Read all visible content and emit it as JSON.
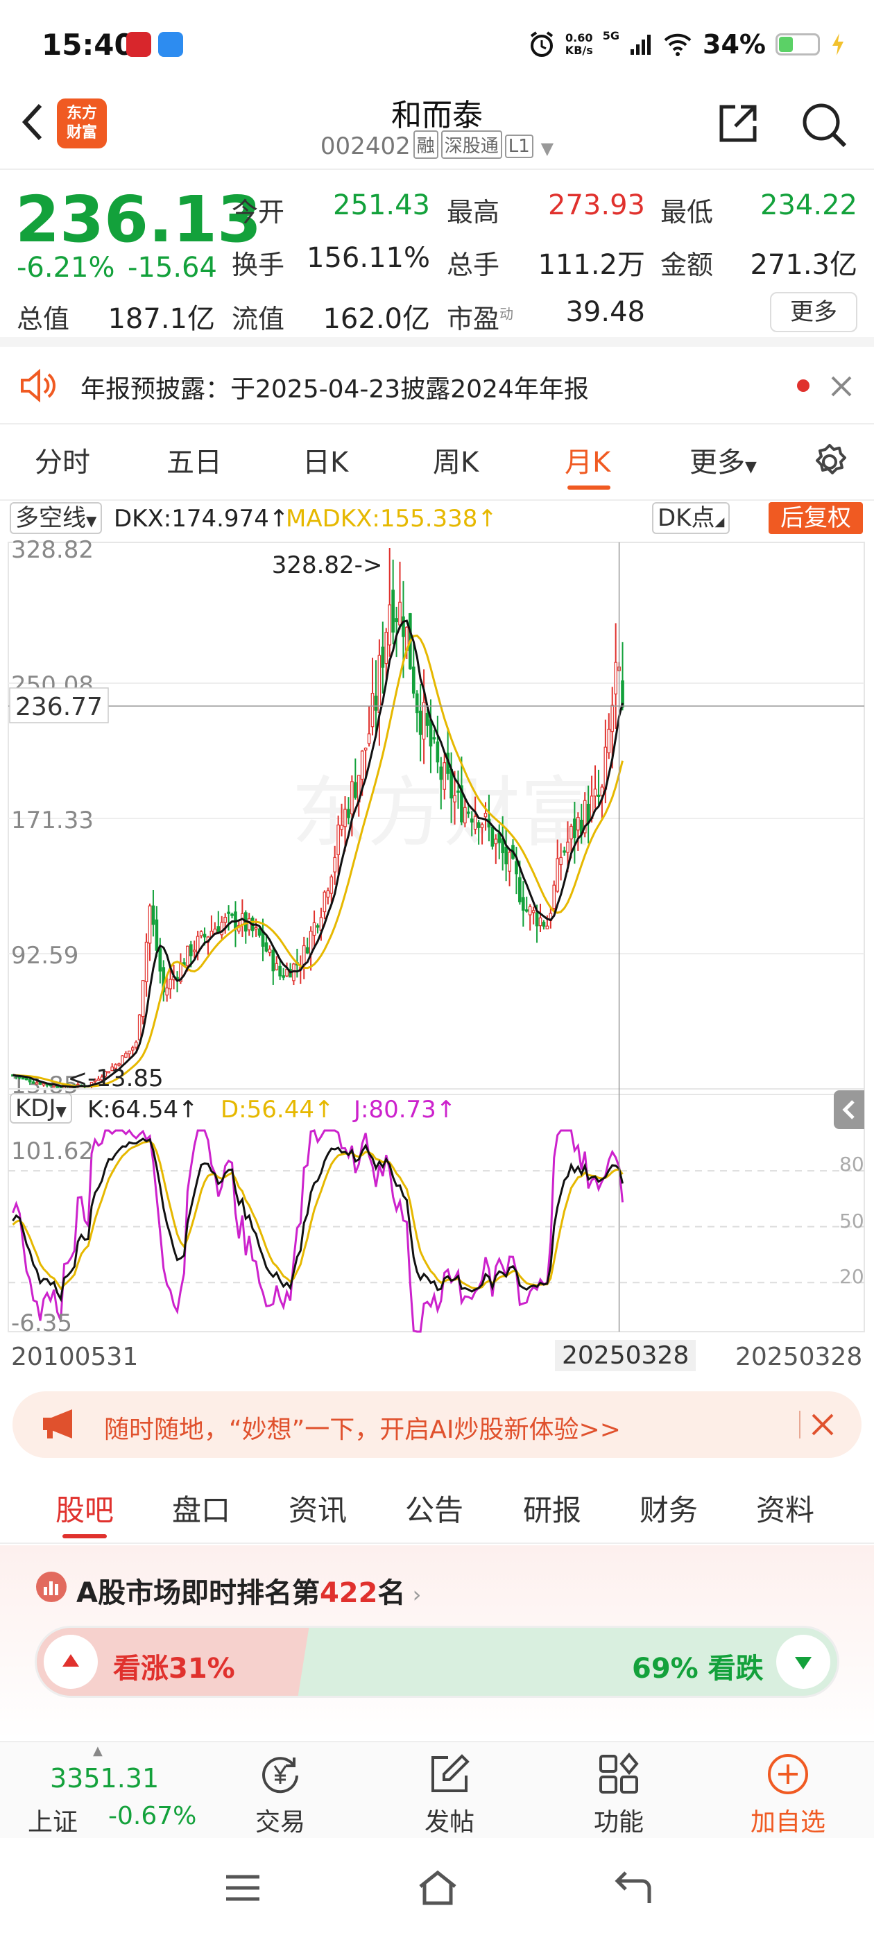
{
  "status_bar": {
    "time": "15:40",
    "net_speed": "0.60",
    "net_unit": "KB/s",
    "net_type": "5G",
    "battery": "34%"
  },
  "header": {
    "logo_line1": "东方",
    "logo_line2": "财富",
    "stock_name": "和而泰",
    "stock_code": "002402",
    "tag_margin": "融",
    "tag_connect": "深股通",
    "tag_level": "L1"
  },
  "quote": {
    "price": "236.13",
    "change_pct": "-6.21%",
    "change_amt": "-15.64",
    "open_label": "今开",
    "open_value": "251.43",
    "high_label": "最高",
    "high_value": "273.93",
    "low_label": "最低",
    "low_value": "234.22",
    "turnover_label": "换手",
    "turnover_value": "156.11%",
    "volume_label": "总手",
    "volume_value": "111.2万",
    "amount_label": "金额",
    "amount_value": "271.3亿",
    "mktcap_label": "总值",
    "mktcap_value": "187.1亿",
    "float_label": "流值",
    "float_value": "162.0亿",
    "pe_label": "市盈",
    "pe_sup": "动",
    "pe_value": "39.48",
    "more_label": "更多"
  },
  "notice": {
    "text": "年报预披露：于2025-04-23披露2024年年报"
  },
  "chart_tabs": {
    "items": [
      "分时",
      "五日",
      "日K",
      "周K",
      "月K"
    ],
    "more": "更多",
    "active_index": 4
  },
  "indicator": {
    "main_selector": "多空线",
    "dkx": "DKX:174.974",
    "madkx": "MADKX:155.338",
    "dk_button": "DK点",
    "adjust_button": "后复权"
  },
  "chart_data": {
    "type": "candlestick",
    "y_labels": [
      "328.82",
      "250.08",
      "171.33",
      "92.59",
      "13.85"
    ],
    "ylim": [
      13.85,
      328.82
    ],
    "crosshair_value": "236.77",
    "high_marker": "328.82->",
    "low_marker": "<-13.85",
    "x_start": "20100531",
    "x_cursor": "20250328",
    "x_end": "20250328",
    "kdj_label": "KDJ",
    "kdj_k": "K:64.54",
    "kdj_d": "D:56.44",
    "kdj_j": "J:80.73",
    "kdj_ylim_labels": [
      "101.62",
      "-6.35"
    ],
    "kdj_levels": [
      "80",
      "50",
      "20"
    ],
    "colors": {
      "up": "#e0312d",
      "down": "#13a13b",
      "dkx": "#111111",
      "madkx": "#e6b800",
      "k": "#111111",
      "d": "#e6b800",
      "j": "#cc22cc"
    }
  },
  "ai_banner": {
    "text": "随时随地，“妙想”一下，开启AI炒股新体验>>"
  },
  "bottom_tabs": {
    "items": [
      "股吧",
      "盘口",
      "资讯",
      "公告",
      "研报",
      "财务",
      "资料"
    ],
    "active_index": 0
  },
  "ranking": {
    "title_prefix": "A股市场即时排名第",
    "rank": "422",
    "title_suffix": "名",
    "bull_label": "看涨31%",
    "bear_label": "69% 看跌"
  },
  "bottom_nav": {
    "index_value": "3351.31",
    "index_name": "上证",
    "index_change": "-0.67%",
    "trade": "交易",
    "post": "发帖",
    "function": "功能",
    "add_watch": "加自选"
  }
}
